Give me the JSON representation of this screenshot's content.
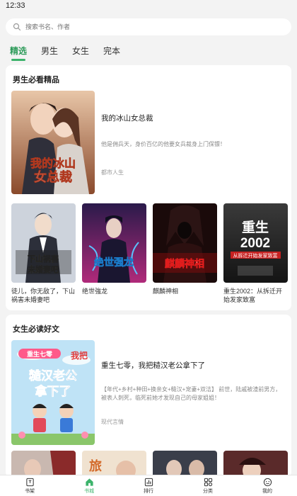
{
  "status_bar": {
    "time": "12:33"
  },
  "search": {
    "placeholder": "搜索书名、作者"
  },
  "tabs": [
    {
      "label": "精选",
      "active": true
    },
    {
      "label": "男生",
      "active": false
    },
    {
      "label": "女生",
      "active": false
    },
    {
      "label": "完本",
      "active": false
    }
  ],
  "male_section": {
    "title": "男生必看精品",
    "featured": {
      "title": "我的冰山女总裁",
      "desc": "他是佣兵天，身价百亿的他要女兵裁身上门保镖！",
      "tag": "都市人生",
      "cover_text": "我的冰山女总裁"
    },
    "books": [
      {
        "title": "徒儿，你无敌了，下山祸害未婚妻吧",
        "cover_text": "下山祸害未婚妻吧"
      },
      {
        "title": "绝世強龙",
        "cover_text": "绝世强龙"
      },
      {
        "title": "麒麟神相",
        "cover_text": "麒麟神相"
      },
      {
        "title": "重生2002：从拆迁开始发家致富",
        "cover_text": "重生2002"
      }
    ]
  },
  "female_section": {
    "title": "女生必读好文",
    "featured": {
      "title": "重生七零，我把糙汉老公拿下了",
      "desc": "【年代+乡村+种田+换亲女+糙汉+宠妻+双洁】 前世，陆戚被渣前男方，被表人刺死，临死前她才发现自己的母家姐姐！",
      "tag": "现代言情",
      "cover_text": "糙汉老公拿下了"
    }
  },
  "bottom_nav": [
    {
      "label": "书架",
      "icon": "bookshelf-icon",
      "active": false
    },
    {
      "label": "书城",
      "icon": "home-icon",
      "active": true
    },
    {
      "label": "排行",
      "icon": "ranking-icon",
      "active": false
    },
    {
      "label": "分类",
      "icon": "category-icon",
      "active": false
    },
    {
      "label": "我的",
      "icon": "profile-icon",
      "active": false
    }
  ],
  "colors": {
    "accent": "#3cb36b",
    "background": "#f3f3f3"
  }
}
